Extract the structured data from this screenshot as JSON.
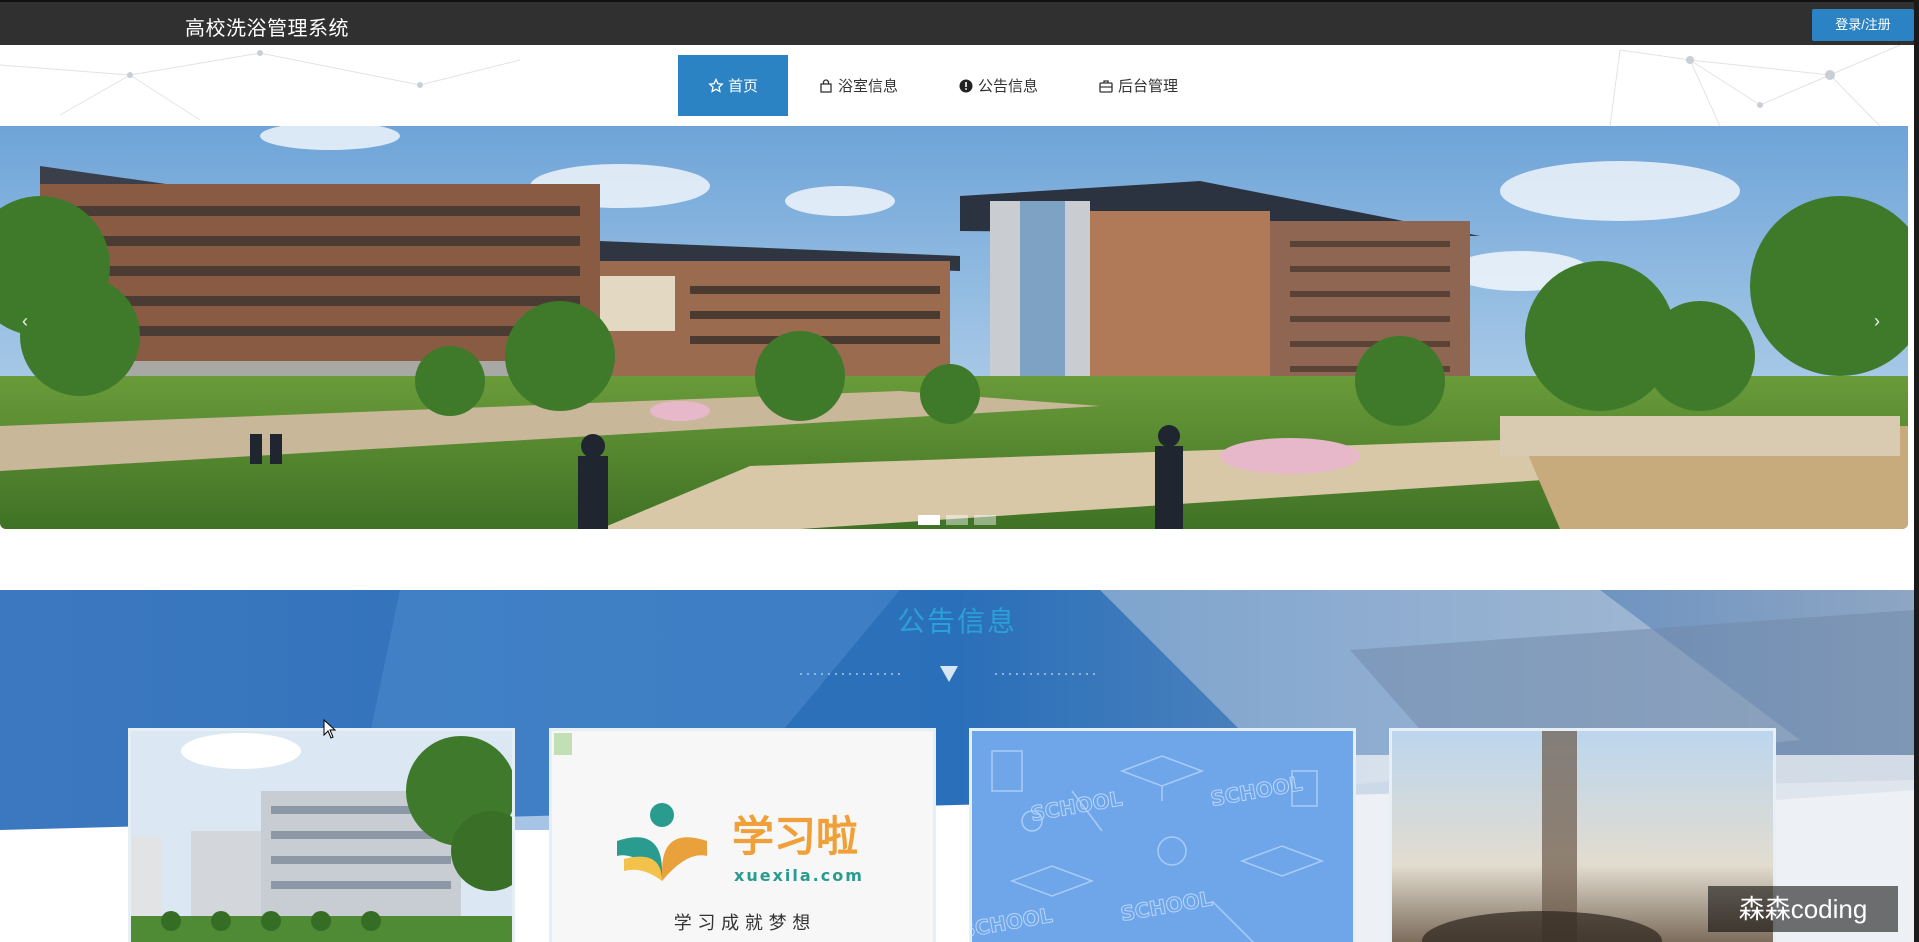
{
  "header": {
    "site_title": "高校洗浴管理系统",
    "login_label": "登录/注册"
  },
  "nav": {
    "items": [
      {
        "label": "首页",
        "icon": "star-icon",
        "active": true
      },
      {
        "label": "浴室信息",
        "icon": "bag-icon",
        "active": false
      },
      {
        "label": "公告信息",
        "icon": "alert-circle-icon",
        "active": false
      },
      {
        "label": "后台管理",
        "icon": "briefcase-icon",
        "active": false
      }
    ]
  },
  "banner": {
    "prev_arrow": "‹",
    "next_arrow": "›",
    "slides": 3,
    "active_slide": 1
  },
  "notice": {
    "title": "公告信息",
    "cards": [
      {
        "image": "campus-building"
      },
      {
        "image": "xuexila-logo",
        "logo_main": "学习啦",
        "logo_domain": "xuexila.com",
        "slogan": "学 习 成 就 梦 想"
      },
      {
        "image": "school-doodle-pattern",
        "pattern_text": "SCHOOL"
      },
      {
        "image": "blurred-photo"
      }
    ]
  },
  "watermark": "森森coding",
  "colors": {
    "topbar": "#303030",
    "accent": "#2b83c3",
    "notice_title": "#2b9fd8"
  }
}
